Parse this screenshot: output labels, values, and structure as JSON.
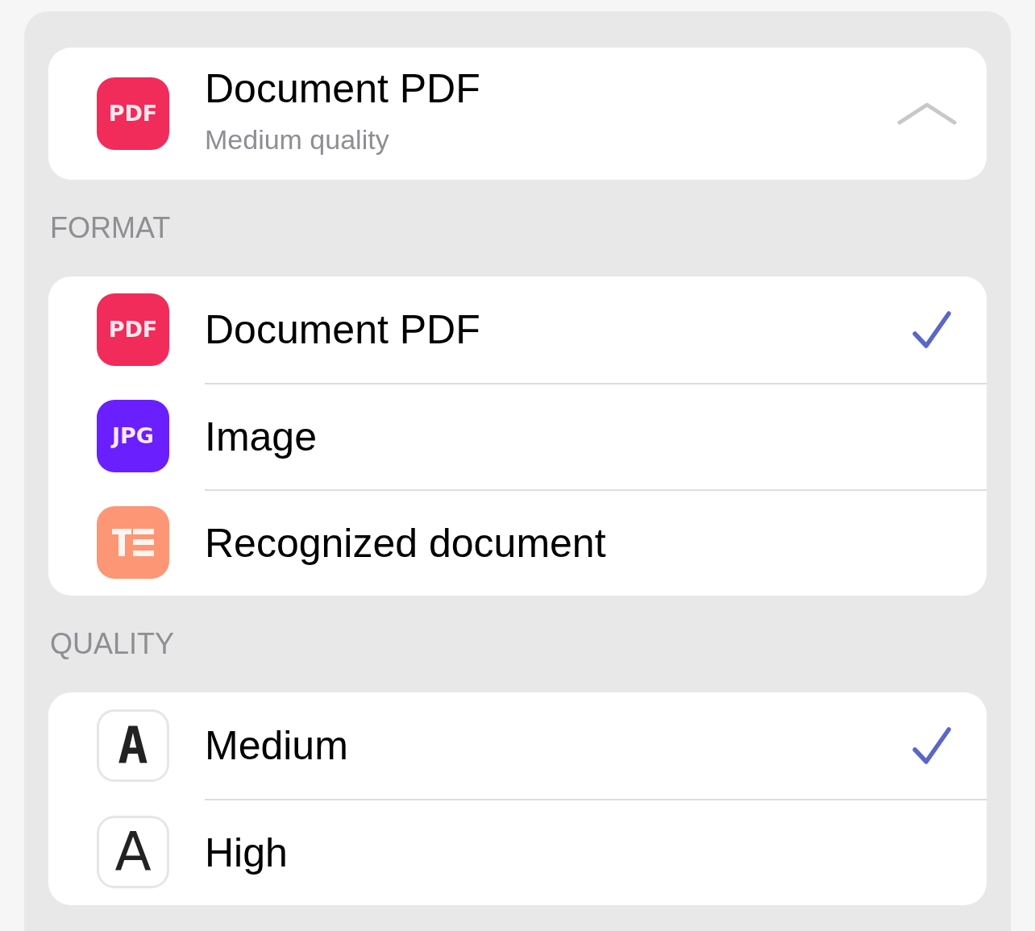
{
  "header": {
    "title": "Document PDF",
    "subtitle": "Medium quality",
    "expanded": true,
    "icon": {
      "kind": "badge",
      "text": "PDF",
      "color": "#f12b5a"
    }
  },
  "sections": [
    {
      "heading": "FORMAT",
      "options": [
        {
          "label": "Document PDF",
          "selected": true,
          "icon": {
            "kind": "badge",
            "text": "PDF",
            "color": "#f12b5a"
          }
        },
        {
          "label": "Image",
          "selected": false,
          "icon": {
            "kind": "badge",
            "text": "JPG",
            "color": "#6a1fff"
          }
        },
        {
          "label": "Recognized document",
          "selected": false,
          "icon": {
            "kind": "text-lines",
            "color": "#fd9674"
          }
        }
      ]
    },
    {
      "heading": "QUALITY",
      "options": [
        {
          "label": "Medium",
          "selected": true,
          "icon": {
            "kind": "pixel-letter",
            "text": "A"
          }
        },
        {
          "label": "High",
          "selected": false,
          "icon": {
            "kind": "letter",
            "text": "A"
          }
        }
      ]
    }
  ]
}
